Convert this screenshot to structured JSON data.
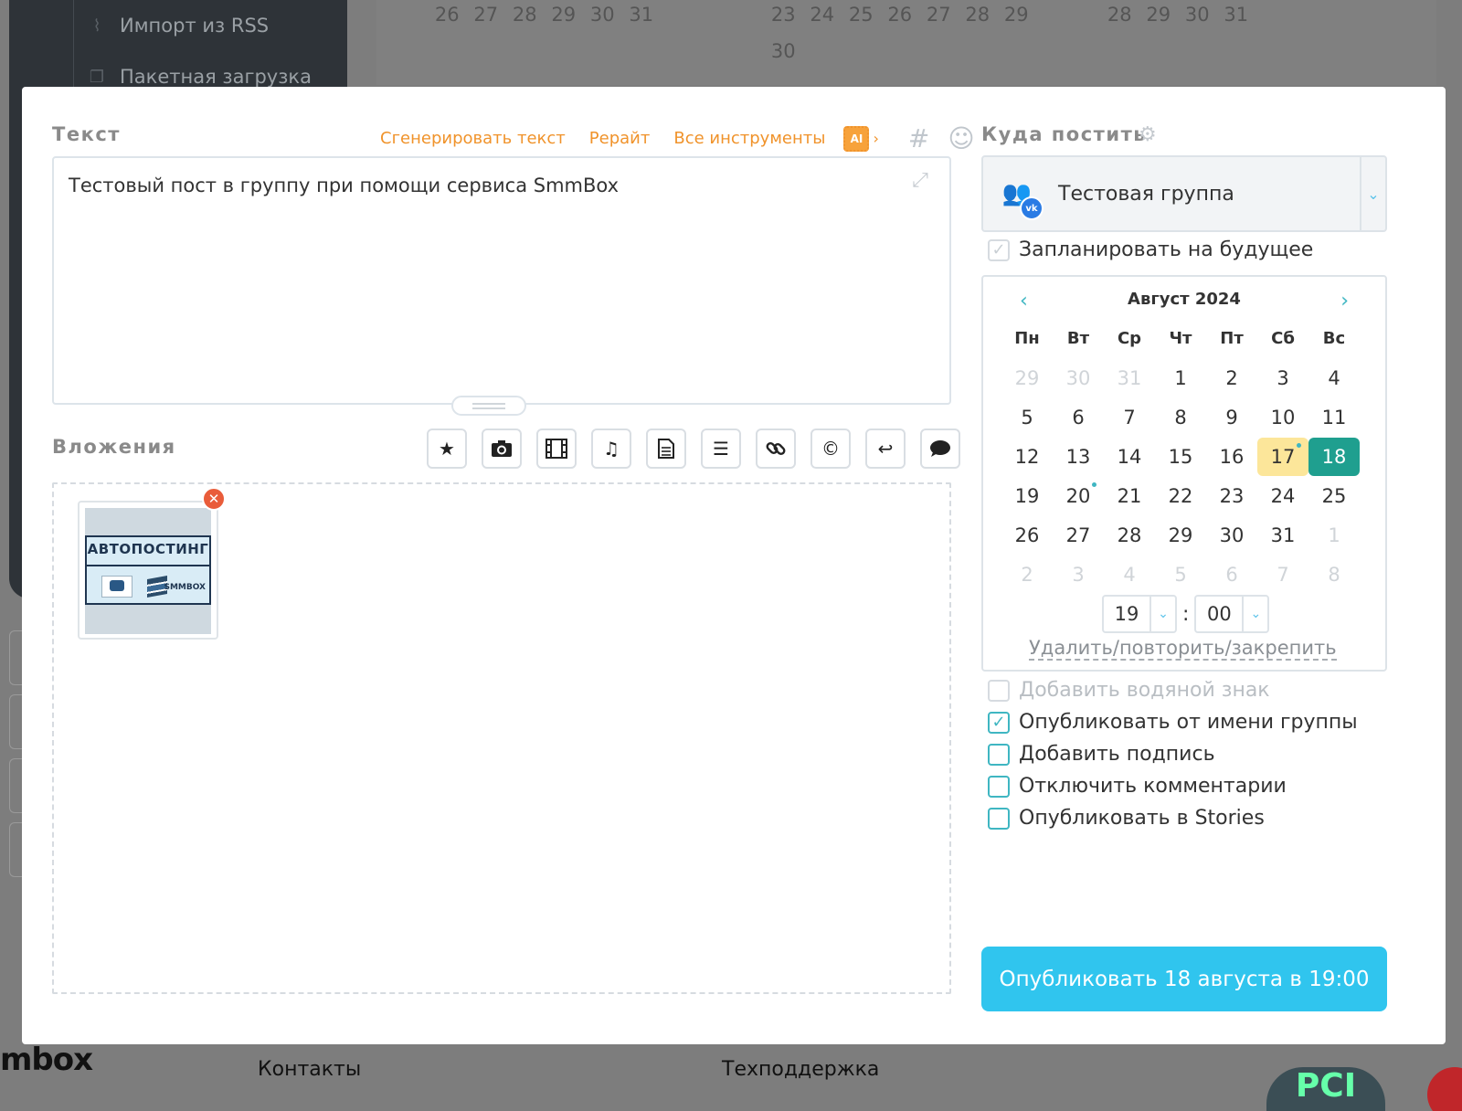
{
  "background": {
    "sidebar": {
      "rss": "Импорт из RSS",
      "batch": "Пакетная загрузка"
    },
    "calendar_rows": [
      [
        "26",
        "27",
        "28",
        "29",
        "30",
        "31"
      ],
      [
        "23",
        "24",
        "25",
        "26",
        "27",
        "28",
        "29"
      ],
      [
        "30"
      ],
      [
        "28",
        "29",
        "30",
        "31"
      ]
    ],
    "footer": {
      "logo": "mbox",
      "contacts": "Контакты",
      "support": "Техподдержка",
      "pci": "PCI"
    }
  },
  "text_section": {
    "label": "Текст",
    "generate": "Сгенерировать текст",
    "rewrite": "Рерайт",
    "all_tools": "Все инструменты",
    "ai": "AI",
    "hash": "#",
    "content": "Тестовый пост в группу при помощи сервиса SmmBox"
  },
  "attachments": {
    "label": "Вложения",
    "thumb_title": "АВТОПОСТИНГ",
    "thumb_brand": "SMMBOX",
    "buttons": [
      "star-icon",
      "camera-icon",
      "film-icon",
      "music-icon",
      "document-icon",
      "list-icon",
      "link-icon",
      "copyright-icon",
      "reply-icon",
      "comment-icon"
    ]
  },
  "target": {
    "label": "Куда постить",
    "group": "Тестовая группа",
    "vk": "vk"
  },
  "schedule": {
    "label": "Запланировать на будущее",
    "checked": true
  },
  "calendar": {
    "month": "Август 2024",
    "weekdays": [
      "Пн",
      "Вт",
      "Ср",
      "Чт",
      "Пт",
      "Сб",
      "Вс"
    ],
    "weeks": [
      [
        "29",
        "30",
        "31",
        "1",
        "2",
        "3",
        "4"
      ],
      [
        "5",
        "6",
        "7",
        "8",
        "9",
        "10",
        "11"
      ],
      [
        "12",
        "13",
        "14",
        "15",
        "16",
        "17",
        "18"
      ],
      [
        "19",
        "20",
        "21",
        "22",
        "23",
        "24",
        "25"
      ],
      [
        "26",
        "27",
        "28",
        "29",
        "30",
        "31",
        "1"
      ],
      [
        "2",
        "3",
        "4",
        "5",
        "6",
        "7",
        "8"
      ]
    ],
    "today": "17",
    "selected": "18",
    "hour": "19",
    "minute": "00",
    "colon": ":",
    "action_link": "Удалить/повторить/закрепить"
  },
  "options": [
    {
      "label": "Добавить водяной знак",
      "checked": false,
      "disabled": true
    },
    {
      "label": "Опубликовать от имени группы",
      "checked": true,
      "disabled": false
    },
    {
      "label": "Добавить подпись",
      "checked": false,
      "disabled": false
    },
    {
      "label": "Отключить комментарии",
      "checked": false,
      "disabled": false
    },
    {
      "label": "Опубликовать в Stories",
      "checked": false,
      "disabled": false
    }
  ],
  "publish_button": "Опубликовать 18 августа в 19:00",
  "colors": {
    "accent": "#30c5ee",
    "orange": "#f0932b",
    "teal": "#1f9f8f",
    "today": "#fce69a"
  }
}
